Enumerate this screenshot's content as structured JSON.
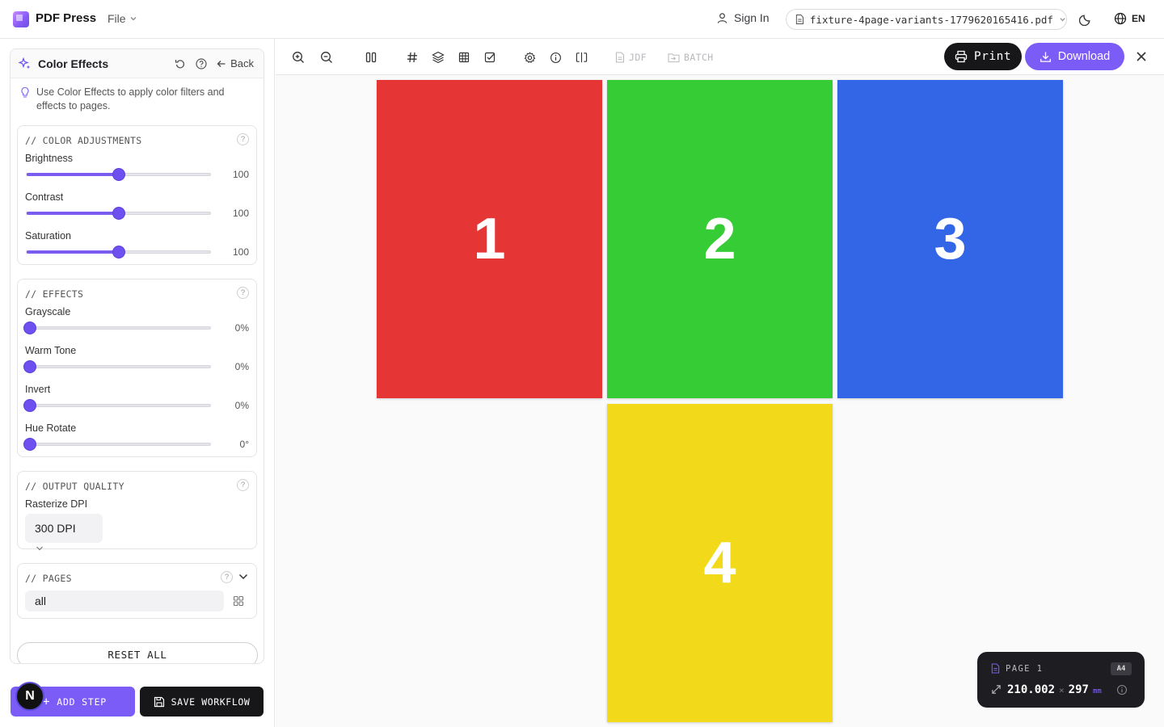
{
  "app": {
    "title": "PDF Press",
    "file_menu": "File"
  },
  "header": {
    "sign_in": "Sign In",
    "file_name": "fixture-4page-variants-1779620165416.pdf",
    "language": "EN"
  },
  "tool": {
    "title": "Color Effects",
    "back": "Back",
    "hint": "Use Color Effects to apply color filters and effects to pages.",
    "sections": {
      "color_adjustments": {
        "title": "// COLOR ADJUSTMENTS",
        "controls": [
          {
            "label": "Brightness",
            "value": "100",
            "fraction": 0.5
          },
          {
            "label": "Contrast",
            "value": "100",
            "fraction": 0.5
          },
          {
            "label": "Saturation",
            "value": "100",
            "fraction": 0.5
          }
        ]
      },
      "effects": {
        "title": "// EFFECTS",
        "controls": [
          {
            "label": "Grayscale",
            "value": "0%",
            "fraction": 0
          },
          {
            "label": "Warm Tone",
            "value": "0%",
            "fraction": 0
          },
          {
            "label": "Invert",
            "value": "0%",
            "fraction": 0
          },
          {
            "label": "Hue Rotate",
            "value": "0°",
            "fraction": 0
          }
        ]
      },
      "output_quality": {
        "title": "// OUTPUT QUALITY",
        "dpi_label": "Rasterize DPI",
        "dpi_value": "300 DPI"
      },
      "pages": {
        "title": "// PAGES",
        "value": "all"
      }
    },
    "reset": "RESET ALL"
  },
  "footer": {
    "add_step": "ADD STEP",
    "save_workflow": "SAVE WORKFLOW",
    "badge": "N"
  },
  "toolbar": {
    "jdf": "JDF",
    "batch": "BATCH",
    "print": "Print",
    "download": "Download"
  },
  "pages": [
    {
      "number": "1",
      "color": "#e63535"
    },
    {
      "number": "2",
      "color": "#35cc35"
    },
    {
      "number": "3",
      "color": "#3366e6"
    },
    {
      "number": "4",
      "color": "#f2d91a"
    }
  ],
  "page_info": {
    "label": "PAGE 1",
    "size": "A4",
    "width": "210.002",
    "height": "297",
    "unit": "mm"
  },
  "colors": {
    "accent": "#7b5cf6",
    "dark": "#17171a"
  }
}
